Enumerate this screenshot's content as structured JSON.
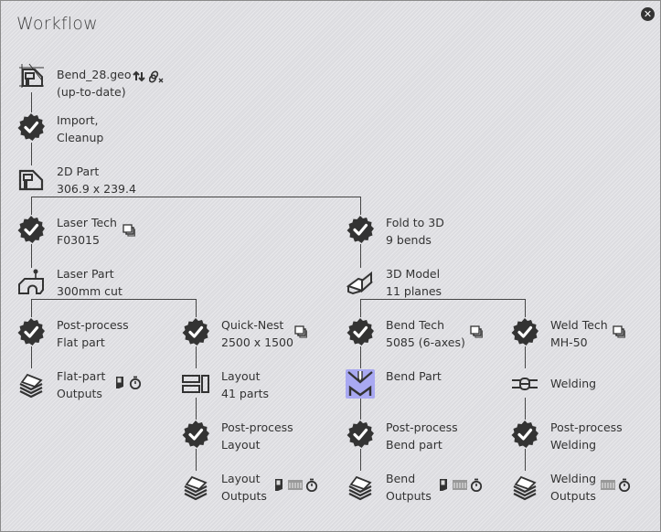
{
  "title": "Workflow",
  "close_icon": "close-icon",
  "nodes": {
    "geo": {
      "line1": "Bend_28.geo",
      "line2": "(up-to-date)",
      "icon": "drawing-file-icon",
      "extras": [
        "update-icon",
        "unlink-icon"
      ]
    },
    "import": {
      "line1": "Import,",
      "line2": "Cleanup",
      "icon": "check-badge-icon"
    },
    "part2d": {
      "line1": "2D Part",
      "line2": "306.9 x 239.4",
      "icon": "flat-part-icon"
    },
    "lasertech": {
      "line1": "Laser Tech",
      "line2": "F03015",
      "icon": "check-badge-icon",
      "extras": [
        "copy-icon"
      ]
    },
    "laserpart": {
      "line1": "Laser Part",
      "line2": "300mm cut",
      "icon": "laser-part-icon"
    },
    "fold": {
      "line1": "Fold to 3D",
      "line2": "9 bends",
      "icon": "check-badge-icon"
    },
    "model3d": {
      "line1": "3D Model",
      "line2": "11 planes",
      "icon": "3d-model-icon"
    },
    "ppflat": {
      "line1": "Post-process",
      "line2": "Flat part",
      "icon": "check-badge-icon"
    },
    "flatout": {
      "line1": "Flat-part",
      "line2": "Outputs",
      "icon": "stack-icon",
      "extras": [
        "document-icon",
        "stopwatch-icon"
      ]
    },
    "quicknest": {
      "line1": "Quick-Nest",
      "line2": "2500 x 1500",
      "icon": "check-badge-icon",
      "extras": [
        "copy-icon"
      ]
    },
    "layout": {
      "line1": "Layout",
      "line2": "41 parts",
      "icon": "layout-icon"
    },
    "pplayout": {
      "line1": "Post-process",
      "line2": "Layout",
      "icon": "check-badge-icon"
    },
    "layoutout": {
      "line1": "Layout",
      "line2": "Outputs",
      "icon": "stack-icon",
      "extras": [
        "document-icon",
        "report-icon",
        "stopwatch-icon"
      ]
    },
    "bendtech": {
      "line1": "Bend Tech",
      "line2": "5085 (6-axes)",
      "icon": "check-badge-icon",
      "extras": [
        "copy-icon"
      ]
    },
    "bendpart": {
      "line1": "Bend Part",
      "line2": "",
      "icon": "press-brake-icon"
    },
    "ppbend": {
      "line1": "Post-process",
      "line2": "Bend part",
      "icon": "check-badge-icon"
    },
    "bendout": {
      "line1": "Bend",
      "line2": "Outputs",
      "icon": "stack-icon",
      "extras": [
        "document-icon",
        "report-icon",
        "stopwatch-icon"
      ]
    },
    "weldtech": {
      "line1": "Weld Tech",
      "line2": "MH-50",
      "icon": "check-badge-icon",
      "extras": [
        "copy-icon"
      ]
    },
    "welding": {
      "line1": "Welding",
      "line2": "",
      "icon": "welding-icon"
    },
    "ppweld": {
      "line1": "Post-process",
      "line2": "Welding",
      "icon": "check-badge-icon"
    },
    "weldout": {
      "line1": "Welding",
      "line2": "Outputs",
      "icon": "stack-icon",
      "extras": [
        "report-icon",
        "stopwatch-icon"
      ]
    }
  },
  "colors": {
    "accent_highlight": "#a9a9f2",
    "icon_dark": "#333333"
  }
}
